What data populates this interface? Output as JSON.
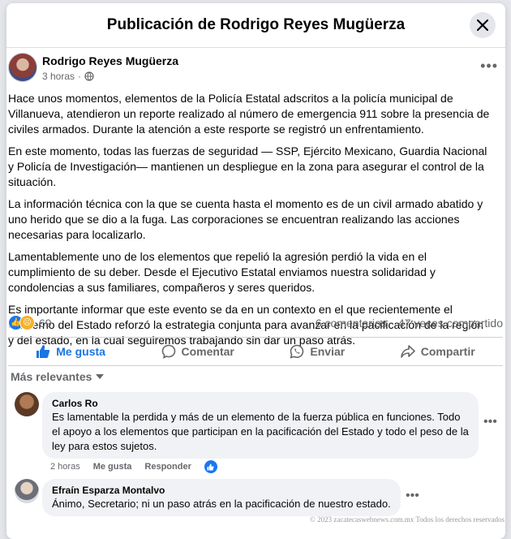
{
  "modal": {
    "title": "Publicación de Rodrigo Reyes Mugüerza"
  },
  "post": {
    "author": "Rodrigo Reyes Mugüerza",
    "time": "3 horas",
    "separator": "·",
    "privacy_icon": "globe-icon",
    "paragraphs": [
      "Hace unos momentos, elementos de la Policía Estatal adscritos a la policía municipal de Villanueva, atendieron un reporte realizado al número de emergencia 911 sobre la presencia de civiles armados. Durante la atención a este resporte se registró un enfrentamiento.",
      "En este momento, todas las fuerzas de seguridad — SSP, Ejército Mexicano, Guardia Nacional y Policía de Investigación— mantienen un despliegue en la zona para asegurar el control de la situación.",
      "La información técnica con la que se cuenta hasta el momento es de un civil armado abatido y uno herido que se dio a la fuga. Las corporaciones se encuentran realizando las acciones necesarias para localizarlo.",
      "Lamentablemente uno de los elementos que repelió la agresión perdió la vida en el cumplimiento de su deber. Desde el Ejecutivo Estatal enviamos nuestra solidaridad y condolencias a sus familiares, compañeros y seres queridos.",
      "Es importante informar que este evento se da en un contexto en el que recientemente el Gobierno del Estado reforzó la estrategia conjunta para avanzar en la pacificación de la región y del estado, en la cual seguiremos trabajando sin dar un paso atrás."
    ],
    "reaction_count": "69",
    "comments_count": "6 comentarios",
    "shares_count": "47 veces compartido"
  },
  "actions": {
    "like": "Me gusta",
    "comment": "Comentar",
    "send": "Enviar",
    "share": "Compartir"
  },
  "sort_label": "Más relevantes",
  "comments": [
    {
      "name": "Carlos Ro",
      "text": "Es lamentable la perdida y más de un elemento de la fuerza pública en funciones. Todo el apoyo a los elementos que participan en la pacificación del Estado y todo el peso de la ley para estos sujetos.",
      "time": "2 horas",
      "like": "Me gusta",
      "reply": "Responder"
    },
    {
      "name": "Efraín Esparza Montalvo",
      "text": "Ánimo, Secretario; ni un paso atrás en la pacificación de nuestro estado."
    }
  ],
  "watermark": "© 2023 zacatecaswebnews.com.mx Todos los derechos reservados",
  "colors": {
    "accent": "#1b74e4",
    "secondary_text": "#65676b"
  }
}
